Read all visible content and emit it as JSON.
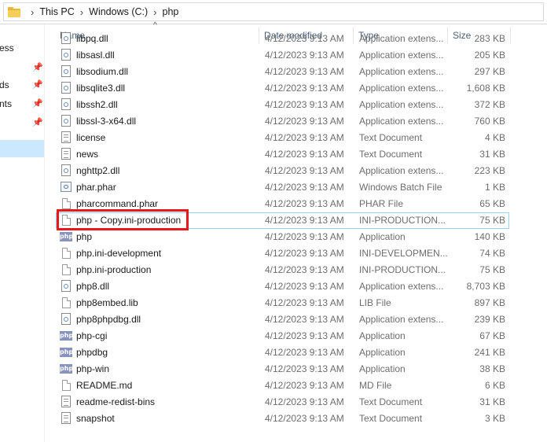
{
  "address": {
    "crumbs": [
      "This PC",
      "Windows (C:)",
      "php"
    ]
  },
  "nav": {
    "items": [
      {
        "label": "ess",
        "pinned": false
      },
      {
        "label": "",
        "pinned": true
      },
      {
        "label": "ds",
        "pinned": true
      },
      {
        "label": "nts",
        "pinned": true
      },
      {
        "label": "",
        "pinned": true
      }
    ]
  },
  "columns": {
    "name": "Name",
    "date": "Date modified",
    "type": "Type",
    "size": "Size"
  },
  "files": [
    {
      "name": "libpq.dll",
      "date": "4/12/2023 9:13 AM",
      "type": "Application extens...",
      "size": "283 KB",
      "icon": "dll-icon"
    },
    {
      "name": "libsasl.dll",
      "date": "4/12/2023 9:13 AM",
      "type": "Application extens...",
      "size": "205 KB",
      "icon": "dll-icon"
    },
    {
      "name": "libsodium.dll",
      "date": "4/12/2023 9:13 AM",
      "type": "Application extens...",
      "size": "297 KB",
      "icon": "dll-icon"
    },
    {
      "name": "libsqlite3.dll",
      "date": "4/12/2023 9:13 AM",
      "type": "Application extens...",
      "size": "1,608 KB",
      "icon": "dll-icon"
    },
    {
      "name": "libssh2.dll",
      "date": "4/12/2023 9:13 AM",
      "type": "Application extens...",
      "size": "372 KB",
      "icon": "dll-icon"
    },
    {
      "name": "libssl-3-x64.dll",
      "date": "4/12/2023 9:13 AM",
      "type": "Application extens...",
      "size": "760 KB",
      "icon": "dll-icon"
    },
    {
      "name": "license",
      "date": "4/12/2023 9:13 AM",
      "type": "Text Document",
      "size": "4 KB",
      "icon": "text-file-icon"
    },
    {
      "name": "news",
      "date": "4/12/2023 9:13 AM",
      "type": "Text Document",
      "size": "31 KB",
      "icon": "text-file-icon"
    },
    {
      "name": "nghttp2.dll",
      "date": "4/12/2023 9:13 AM",
      "type": "Application extens...",
      "size": "223 KB",
      "icon": "dll-icon"
    },
    {
      "name": "phar.phar",
      "date": "4/12/2023 9:13 AM",
      "type": "Windows Batch File",
      "size": "1 KB",
      "icon": "batch-file-icon"
    },
    {
      "name": "pharcommand.phar",
      "date": "4/12/2023 9:13 AM",
      "type": "PHAR File",
      "size": "65 KB",
      "icon": "blank-file-icon"
    },
    {
      "name": "php - Copy.ini-production",
      "date": "4/12/2023 9:13 AM",
      "type": "INI-PRODUCTION...",
      "size": "75 KB",
      "icon": "blank-file-icon",
      "focused": true,
      "highlighted": true
    },
    {
      "name": "php",
      "date": "4/12/2023 9:13 AM",
      "type": "Application",
      "size": "140 KB",
      "icon": "php-icon"
    },
    {
      "name": "php.ini-development",
      "date": "4/12/2023 9:13 AM",
      "type": "INI-DEVELOPMEN...",
      "size": "74 KB",
      "icon": "blank-file-icon"
    },
    {
      "name": "php.ini-production",
      "date": "4/12/2023 9:13 AM",
      "type": "INI-PRODUCTION...",
      "size": "75 KB",
      "icon": "blank-file-icon"
    },
    {
      "name": "php8.dll",
      "date": "4/12/2023 9:13 AM",
      "type": "Application extens...",
      "size": "8,703 KB",
      "icon": "dll-icon"
    },
    {
      "name": "php8embed.lib",
      "date": "4/12/2023 9:13 AM",
      "type": "LIB File",
      "size": "897 KB",
      "icon": "blank-file-icon"
    },
    {
      "name": "php8phpdbg.dll",
      "date": "4/12/2023 9:13 AM",
      "type": "Application extens...",
      "size": "239 KB",
      "icon": "dll-icon"
    },
    {
      "name": "php-cgi",
      "date": "4/12/2023 9:13 AM",
      "type": "Application",
      "size": "67 KB",
      "icon": "php-icon"
    },
    {
      "name": "phpdbg",
      "date": "4/12/2023 9:13 AM",
      "type": "Application",
      "size": "241 KB",
      "icon": "php-icon"
    },
    {
      "name": "php-win",
      "date": "4/12/2023 9:13 AM",
      "type": "Application",
      "size": "38 KB",
      "icon": "php-icon"
    },
    {
      "name": "README.md",
      "date": "4/12/2023 9:13 AM",
      "type": "MD File",
      "size": "6 KB",
      "icon": "blank-file-icon"
    },
    {
      "name": "readme-redist-bins",
      "date": "4/12/2023 9:13 AM",
      "type": "Text Document",
      "size": "31 KB",
      "icon": "text-file-icon"
    },
    {
      "name": "snapshot",
      "date": "4/12/2023 9:13 AM",
      "type": "Text Document",
      "size": "3 KB",
      "icon": "text-file-icon"
    }
  ],
  "php_icon_text": "php",
  "highlight_color": "#e8181e"
}
